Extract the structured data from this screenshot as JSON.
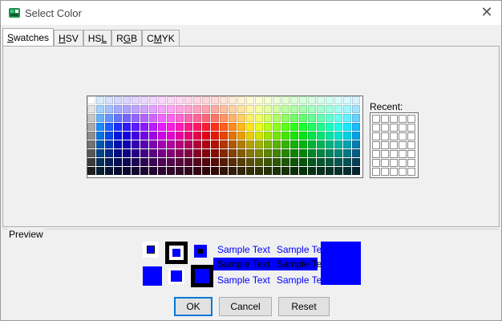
{
  "window": {
    "title": "Select Color"
  },
  "tabs": [
    {
      "pre": "",
      "mn": "S",
      "post": "watches",
      "active": true
    },
    {
      "pre": "",
      "mn": "H",
      "post": "SV",
      "active": false
    },
    {
      "pre": "HS",
      "mn": "L",
      "post": "",
      "active": false
    },
    {
      "pre": "R",
      "mn": "G",
      "post": "B",
      "active": false
    },
    {
      "pre": "C",
      "mn": "M",
      "post": "YK",
      "active": false
    }
  ],
  "swatches": {
    "columns": 31,
    "rows": 9,
    "recent_label": "Recent:",
    "recent_columns": 5,
    "recent_rows": 7
  },
  "preview": {
    "label": "Preview",
    "selected_color": "#0000ff",
    "sample_text": "Sample Text"
  },
  "buttons": {
    "ok": "OK",
    "cancel": "Cancel",
    "reset": "Reset"
  }
}
